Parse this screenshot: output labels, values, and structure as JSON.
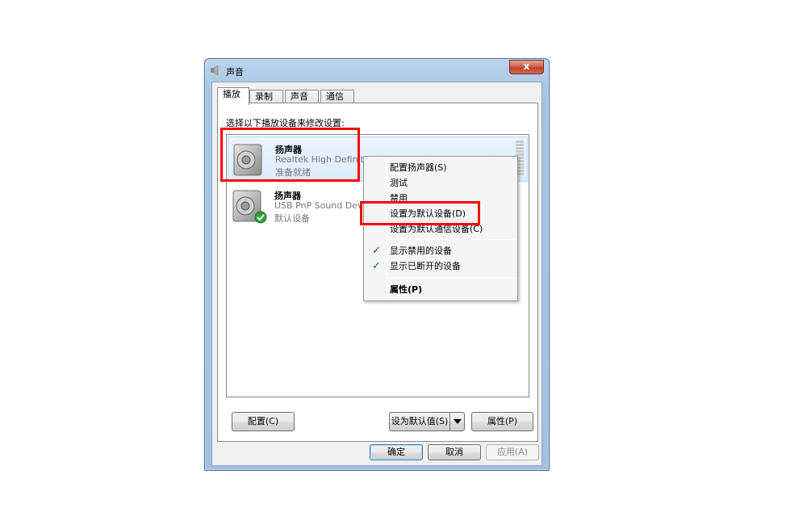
{
  "window": {
    "title": "声音",
    "close_label": "x"
  },
  "tabs": [
    {
      "label": "播放",
      "active": true
    },
    {
      "label": "录制",
      "active": false
    },
    {
      "label": "声音",
      "active": false
    },
    {
      "label": "通信",
      "active": false
    }
  ],
  "instruction": "选择以下播放设备来修改设置:",
  "devices": [
    {
      "name": "扬声器",
      "description": "Realtek High Definit",
      "status": "准备就绪",
      "selected": true,
      "default": false
    },
    {
      "name": "扬声器",
      "description": "USB PnP Sound Devi",
      "status": "默认设备",
      "selected": false,
      "default": true
    }
  ],
  "context_menu": {
    "items": [
      {
        "label": "配置扬声器(S)",
        "checked": false,
        "bold": false
      },
      {
        "label": "测试",
        "checked": false,
        "bold": false
      },
      {
        "label": "禁用",
        "checked": false,
        "bold": false
      },
      {
        "label": "设置为默认设备(D)",
        "checked": false,
        "bold": false
      },
      {
        "label": "设置为默认通信设备(C)",
        "checked": false,
        "bold": false
      },
      {
        "label": "显示禁用的设备",
        "checked": true,
        "bold": false
      },
      {
        "label": "显示已断开的设备",
        "checked": true,
        "bold": false
      },
      {
        "label": "属性(P)",
        "checked": false,
        "bold": true
      }
    ]
  },
  "panel_buttons": {
    "configure": "配置(C)",
    "set_default": "设为默认值(S)",
    "properties": "属性(P)"
  },
  "dialog_buttons": {
    "ok": "确定",
    "cancel": "取消",
    "apply": "应用(A)"
  },
  "colors": {
    "highlight": "#ff0000",
    "selection": "#dcebfc",
    "title_bar": "#a9c5e6",
    "check": "#1c4f8f"
  }
}
